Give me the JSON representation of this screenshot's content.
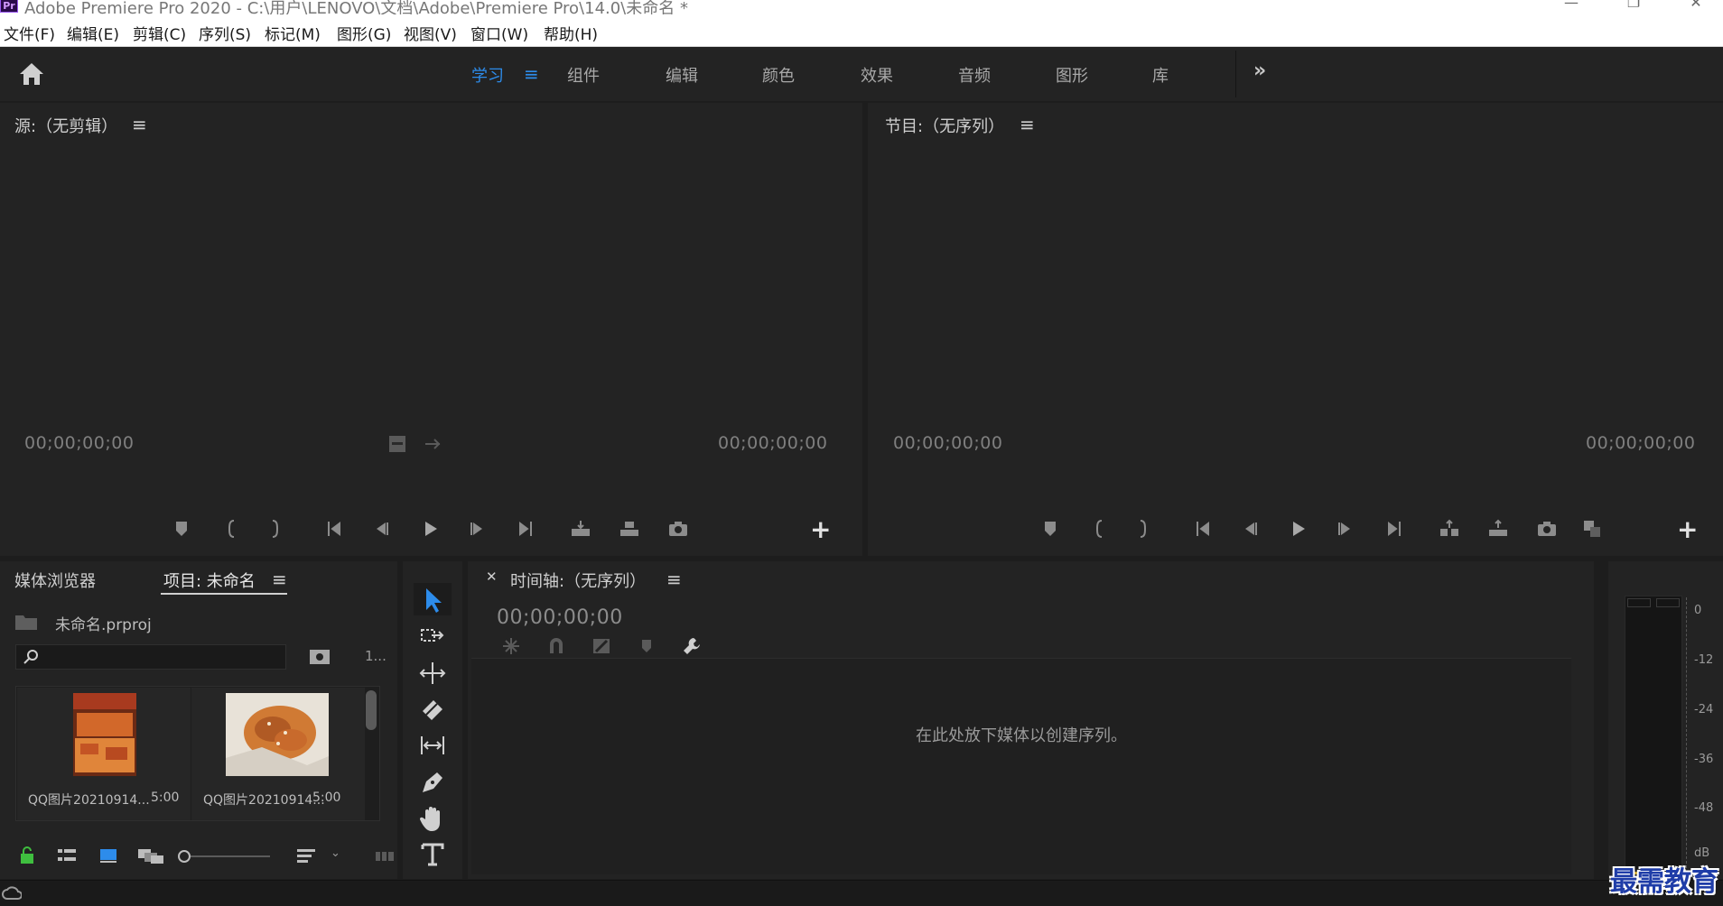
{
  "window": {
    "title": "Adobe Premiere Pro 2020 - C:\\用户\\LENOVO\\文档\\Adobe\\Premiere Pro\\14.0\\未命名 *",
    "app_icon": "Pr",
    "controls": [
      "minimize-icon",
      "restore-icon",
      "close-icon"
    ]
  },
  "menu": [
    "文件(F)",
    "编辑(E)",
    "剪辑(C)",
    "序列(S)",
    "标记(M)",
    "图形(G)",
    "视图(V)",
    "窗口(W)",
    "帮助(H)"
  ],
  "workspaces": {
    "tabs": [
      "学习",
      "组件",
      "编辑",
      "颜色",
      "效果",
      "音频",
      "图形",
      "库"
    ],
    "active": "学习",
    "more_label": "»"
  },
  "source_monitor": {
    "title": "源:（无剪辑）",
    "timecode_left": "00;00;00;00",
    "timecode_right": "00;00;00;00"
  },
  "program_monitor": {
    "title": "节目:（无序列）",
    "timecode_left": "00;00;00;00",
    "timecode_right": "00;00;00;00"
  },
  "project_panel": {
    "tabs": [
      "媒体浏览器",
      "项目: 未命名"
    ],
    "active_tab": "项目: 未命名",
    "file_name": "未命名.prproj",
    "item_count": "1...",
    "search_value": "",
    "items": [
      {
        "name": "QQ图片20210914...",
        "duration": "5:00"
      },
      {
        "name": "QQ图片20210914...",
        "duration": "5:00"
      }
    ]
  },
  "timeline": {
    "title": "时间轴:（无序列）",
    "timecode": "00;00;00;00",
    "drop_hint": "在此处放下媒体以创建序列。"
  },
  "audio_meter": {
    "scale": [
      "0",
      "-12",
      "-24",
      "-36",
      "-48",
      "dB"
    ]
  },
  "watermark": "最需教育",
  "colors": {
    "accent": "#2d8ceb",
    "panel_bg": "#232323",
    "app_bg": "#1d1d1d"
  }
}
